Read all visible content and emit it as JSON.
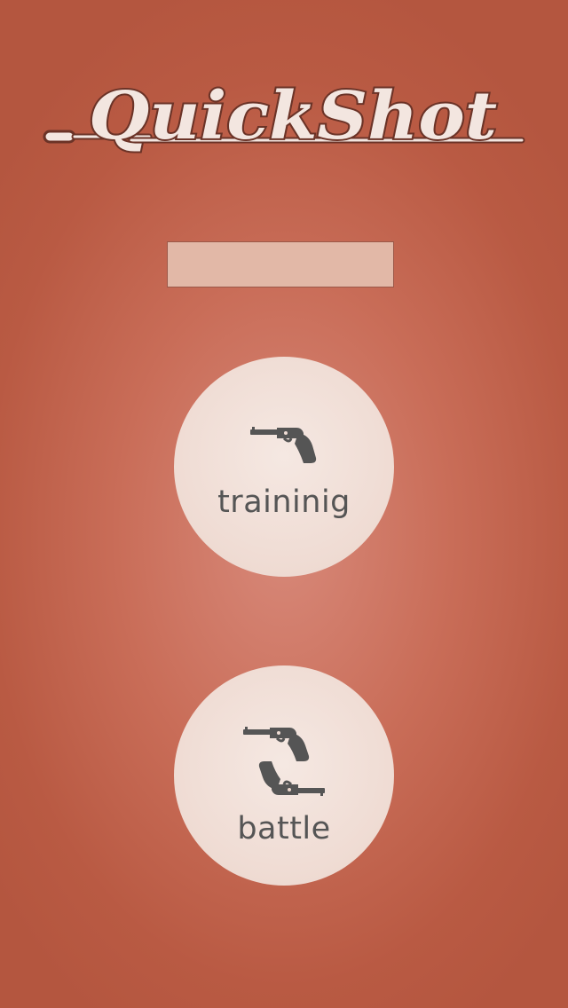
{
  "app": {
    "title": "QuickShot"
  },
  "name_field": {
    "value": ""
  },
  "modes": [
    {
      "label": "traininig",
      "icon": "revolver-icon"
    },
    {
      "label": "battle",
      "icon": "dual-revolvers-icon"
    }
  ],
  "colors": {
    "background": "#c96d58",
    "button_fill": "#f2e2da",
    "button_text": "#555555",
    "logo_fill": "#f3e6e0",
    "logo_outline": "#6b3327",
    "name_box": "#e2b8a7"
  }
}
